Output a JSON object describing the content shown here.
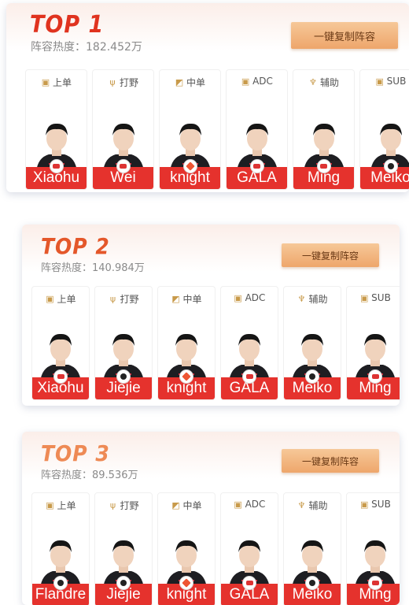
{
  "cards": [
    {
      "rank": "TOP 1",
      "rank_color": "#e0331f",
      "heat": "阵容热度：182.452万",
      "copy_label": "一键复制阵容",
      "players": [
        {
          "role": "上单",
          "icon": "top-lane-icon",
          "glyph": "▣",
          "name": "Xiaohu",
          "badge": "team1"
        },
        {
          "role": "打野",
          "icon": "jungle-icon",
          "glyph": "ψ",
          "name": "Wei",
          "badge": "team1"
        },
        {
          "role": "中单",
          "icon": "mid-lane-icon",
          "glyph": "◩",
          "name": "knight",
          "badge": "team3"
        },
        {
          "role": "ADC",
          "icon": "adc-icon",
          "glyph": "▣",
          "name": "GALA",
          "badge": "team1"
        },
        {
          "role": "辅助",
          "icon": "support-icon",
          "glyph": "♆",
          "name": "Ming",
          "badge": "team1"
        },
        {
          "role": "SUB",
          "icon": "sub-icon",
          "glyph": "▣",
          "name": "Meiko",
          "badge": "team2"
        }
      ]
    },
    {
      "rank": "TOP 2",
      "rank_color": "#e4572a",
      "heat": "阵容热度：140.984万",
      "copy_label": "一键复制阵容",
      "players": [
        {
          "role": "上单",
          "icon": "top-lane-icon",
          "glyph": "▣",
          "name": "Xiaohu",
          "badge": "team1"
        },
        {
          "role": "打野",
          "icon": "jungle-icon",
          "glyph": "ψ",
          "name": "Jiejie",
          "badge": "team2"
        },
        {
          "role": "中单",
          "icon": "mid-lane-icon",
          "glyph": "◩",
          "name": "knight",
          "badge": "team3"
        },
        {
          "role": "ADC",
          "icon": "adc-icon",
          "glyph": "▣",
          "name": "GALA",
          "badge": "team1"
        },
        {
          "role": "辅助",
          "icon": "support-icon",
          "glyph": "♆",
          "name": "Meiko",
          "badge": "team2"
        },
        {
          "role": "SUB",
          "icon": "sub-icon",
          "glyph": "▣",
          "name": "Ming",
          "badge": "team1"
        }
      ]
    },
    {
      "rank": "TOP 3",
      "rank_color": "#ee8a55",
      "heat": "阵容热度：89.536万",
      "copy_label": "一键复制阵容",
      "players": [
        {
          "role": "上单",
          "icon": "top-lane-icon",
          "glyph": "▣",
          "name": "Flandre",
          "badge": "team2"
        },
        {
          "role": "打野",
          "icon": "jungle-icon",
          "glyph": "ψ",
          "name": "Jiejie",
          "badge": "team2"
        },
        {
          "role": "中单",
          "icon": "mid-lane-icon",
          "glyph": "◩",
          "name": "knight",
          "badge": "team3"
        },
        {
          "role": "ADC",
          "icon": "adc-icon",
          "glyph": "▣",
          "name": "GALA",
          "badge": "team1"
        },
        {
          "role": "辅助",
          "icon": "support-icon",
          "glyph": "♆",
          "name": "Meiko",
          "badge": "team2"
        },
        {
          "role": "SUB",
          "icon": "sub-icon",
          "glyph": "▣",
          "name": "Ming",
          "badge": "team1"
        }
      ]
    }
  ]
}
